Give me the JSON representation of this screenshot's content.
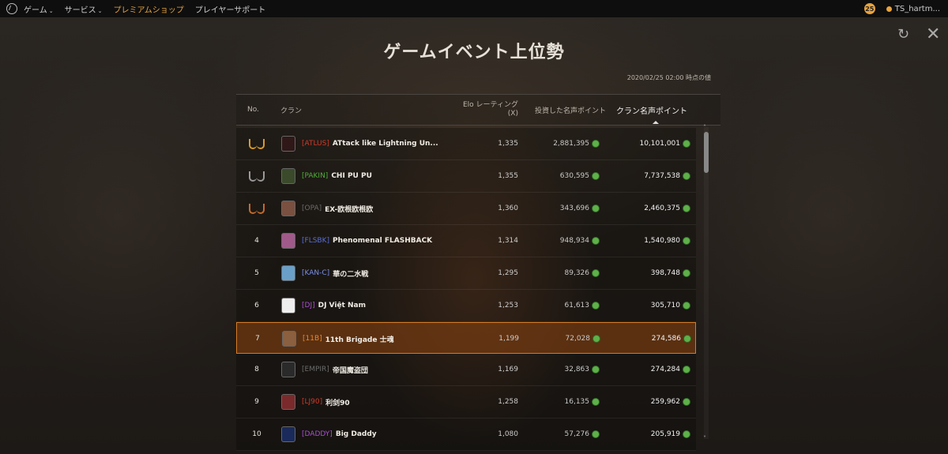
{
  "topbar": {
    "nav": [
      {
        "label": "ゲーム",
        "caret": true,
        "premium": false
      },
      {
        "label": "サービス",
        "caret": true,
        "premium": false
      },
      {
        "label": "プレミアムショップ",
        "caret": false,
        "premium": true
      },
      {
        "label": "プレイヤーサポート",
        "caret": false,
        "premium": false
      }
    ],
    "notifications": "25",
    "username": "TS_hartm..."
  },
  "page": {
    "title": "ゲームイベント上位勢",
    "as_of": "2020/02/25 02:00 時点の値"
  },
  "table": {
    "headers": {
      "no": "No.",
      "clan": "クラン",
      "elo": "Elo レーティング (X)",
      "invested": "投資した名声ポイント",
      "clan_points": "クラン名声ポイント"
    },
    "rows": [
      {
        "no": "",
        "medal": "gold-laurel-icon",
        "tag": "[ATLUS]",
        "tag_color": "#d23a2a",
        "name": "ATtack like Lightning Un...",
        "elo": "1,335",
        "invested": "2,881,395",
        "clan_points": "10,101,001",
        "avatar": "atlus-emblem-icon",
        "avatar_bg": "#301818",
        "me": false
      },
      {
        "no": "",
        "medal": "silver-laurel-icon",
        "tag": "[PAKIN]",
        "tag_color": "#4fae3a",
        "name": "CHI PU PU",
        "elo": "1,355",
        "invested": "630,595",
        "clan_points": "7,737,538",
        "avatar": "pakin-emblem-icon",
        "avatar_bg": "#3a4a2a",
        "me": false
      },
      {
        "no": "",
        "medal": "bronze-laurel-icon",
        "tag": "[OPA]",
        "tag_color": "#6b6b6b",
        "name": "EX-欧根欧根欧",
        "elo": "1,360",
        "invested": "343,696",
        "clan_points": "2,460,375",
        "avatar": "opa-emblem-icon",
        "avatar_bg": "#7a5040",
        "me": false
      },
      {
        "no": "4",
        "medal": "",
        "tag": "[FLSBK]",
        "tag_color": "#5a6ed8",
        "name": "Phenomenal FLASHBACK",
        "elo": "1,314",
        "invested": "948,934",
        "clan_points": "1,540,980",
        "avatar": "flsbk-emblem-icon",
        "avatar_bg": "#a05a8a",
        "me": false
      },
      {
        "no": "5",
        "medal": "",
        "tag": "[KAN-C]",
        "tag_color": "#7a8ee8",
        "name": "華の二水戦",
        "elo": "1,295",
        "invested": "89,326",
        "clan_points": "398,748",
        "avatar": "kanc-emblem-icon",
        "avatar_bg": "#6aa0c8",
        "me": false
      },
      {
        "no": "6",
        "medal": "",
        "tag": "[DJ]",
        "tag_color": "#a94fd0",
        "name": "DJ Việt Nam",
        "elo": "1,253",
        "invested": "61,613",
        "clan_points": "305,710",
        "avatar": "dj-emblem-icon",
        "avatar_bg": "#eeeeee",
        "me": false
      },
      {
        "no": "7",
        "medal": "",
        "tag": "[11B]",
        "tag_color": "#e8872a",
        "name": "11th Brigade 士魂",
        "elo": "1,199",
        "invested": "72,028",
        "clan_points": "274,586",
        "avatar": "11b-emblem-icon",
        "avatar_bg": "#8a6040",
        "me": true
      },
      {
        "no": "8",
        "medal": "",
        "tag": "[EMPIR]",
        "tag_color": "#6b6b6b",
        "name": "帝国魔盗団",
        "elo": "1,169",
        "invested": "32,863",
        "clan_points": "274,284",
        "avatar": "empir-emblem-icon",
        "avatar_bg": "#2a2a2a",
        "me": false
      },
      {
        "no": "9",
        "medal": "",
        "tag": "[LJ90]",
        "tag_color": "#d03a2a",
        "name": "利剑90",
        "elo": "1,258",
        "invested": "16,135",
        "clan_points": "259,962",
        "avatar": "lj90-emblem-icon",
        "avatar_bg": "#7a2a2a",
        "me": false
      },
      {
        "no": "10",
        "medal": "",
        "tag": "[DADDY]",
        "tag_color": "#a94fd0",
        "name": "Big Daddy",
        "elo": "1,080",
        "invested": "57,276",
        "clan_points": "205,919",
        "avatar": "daddy-emblem-icon",
        "avatar_bg": "#1a2a5a",
        "me": false
      }
    ]
  },
  "colors": {
    "accent": "#e8a33d",
    "gold": "#d79a2a",
    "silver": "#9a9a9a",
    "bronze": "#c46a2a"
  }
}
